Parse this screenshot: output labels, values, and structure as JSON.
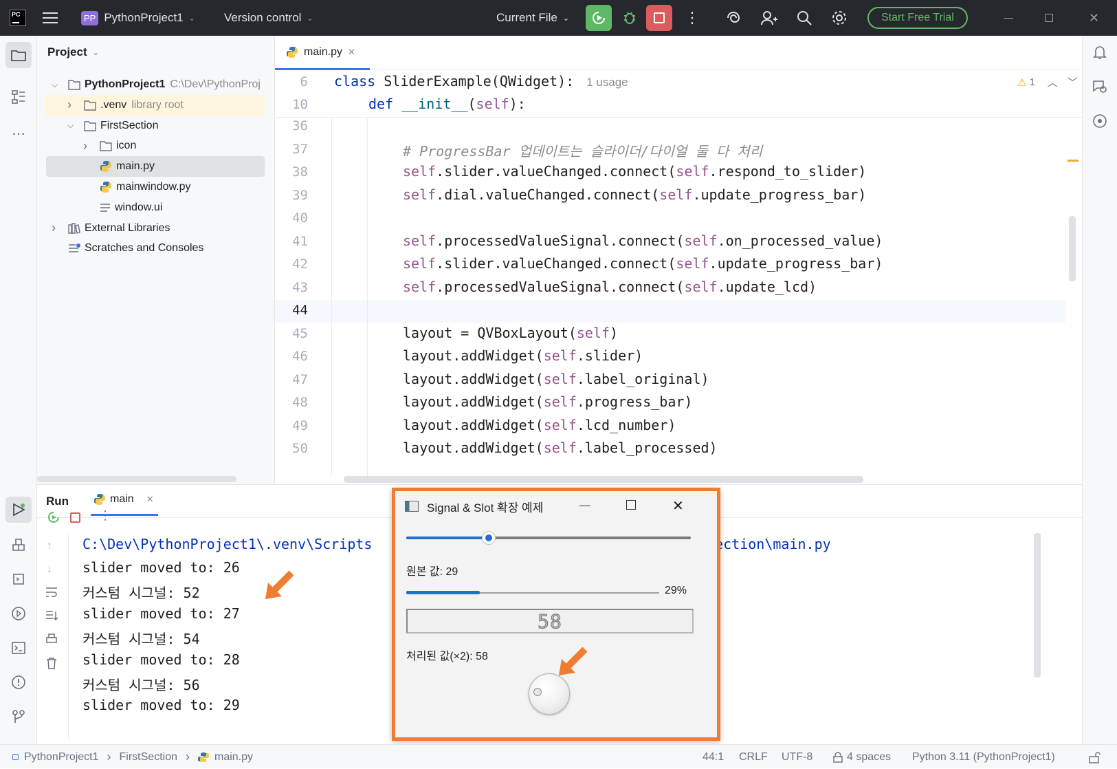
{
  "titlebar": {
    "app_logo": "PC",
    "project_badge": "PP",
    "project_name": "PythonProject1",
    "vcs": "Version control",
    "run_config": "Current File",
    "trial_button": "Start Free Trial",
    "icons": [
      "hamburger-menu-icon",
      "rerun-icon",
      "debug-icon",
      "stop-icon",
      "more-icon",
      "ai-assistant-icon",
      "add-user-icon",
      "search-icon",
      "settings-icon",
      "minimize-icon",
      "maximize-icon",
      "close-icon"
    ]
  },
  "project_panel": {
    "title": "Project",
    "tree": [
      {
        "label": "PythonProject1",
        "extra": "C:\\Dev\\PythonProj",
        "depth": 0,
        "kind": "folder",
        "arrow": "open"
      },
      {
        "label": ".venv",
        "extra": "library root",
        "depth": 1,
        "kind": "folder",
        "arrow": "closed"
      },
      {
        "label": "FirstSection",
        "extra": "",
        "depth": 1,
        "kind": "folder",
        "arrow": "open"
      },
      {
        "label": "icon",
        "extra": "",
        "depth": 2,
        "kind": "folder",
        "arrow": "closed"
      },
      {
        "label": "main.py",
        "extra": "",
        "depth": 2,
        "kind": "python",
        "arrow": "none"
      },
      {
        "label": "mainwindow.py",
        "extra": "",
        "depth": 2,
        "kind": "python",
        "arrow": "none"
      },
      {
        "label": "window.ui",
        "extra": "",
        "depth": 2,
        "kind": "ui",
        "arrow": "none"
      },
      {
        "label": "External Libraries",
        "extra": "",
        "depth": 0,
        "kind": "library",
        "arrow": "closed"
      },
      {
        "label": "Scratches and Consoles",
        "extra": "",
        "depth": 0,
        "kind": "scratch",
        "arrow": "none"
      }
    ]
  },
  "editor": {
    "tab": "main.py",
    "sticky": [
      {
        "num": "6",
        "tokens": [
          [
            "kw",
            "class "
          ],
          [
            "",
            "SliderExample(QWidget):"
          ]
        ],
        "hint": "1 usage",
        "indent": 0
      },
      {
        "num": "10",
        "tokens": [
          [
            "kw",
            "def "
          ],
          [
            "fn",
            "__init__"
          ],
          [
            "",
            "("
          ],
          [
            "sf",
            "self"
          ],
          [
            "",
            "):"
          ]
        ],
        "hint": "",
        "indent": 1
      }
    ],
    "warnings": "1",
    "lines": [
      {
        "num": "36",
        "tokens": []
      },
      {
        "num": "37",
        "tokens": [
          [
            "cm",
            "# ProgressBar 업데이트는 슬라이더/다이얼 둘 다 처리"
          ]
        ]
      },
      {
        "num": "38",
        "tokens": [
          [
            "sf",
            "self"
          ],
          [
            "",
            ".slider.valueChanged.connect("
          ],
          [
            "sf",
            "self"
          ],
          [
            "",
            ".respond_to_slider)"
          ]
        ]
      },
      {
        "num": "39",
        "tokens": [
          [
            "sf",
            "self"
          ],
          [
            "",
            ".dial.valueChanged.connect("
          ],
          [
            "sf",
            "self"
          ],
          [
            "",
            ".update_progress_bar)"
          ]
        ]
      },
      {
        "num": "40",
        "tokens": []
      },
      {
        "num": "41",
        "tokens": [
          [
            "sf",
            "self"
          ],
          [
            "",
            ".processedValueSignal.connect("
          ],
          [
            "sf",
            "self"
          ],
          [
            "",
            ".on_processed_value)"
          ]
        ]
      },
      {
        "num": "42",
        "tokens": [
          [
            "sf",
            "self"
          ],
          [
            "",
            ".slider.valueChanged.connect("
          ],
          [
            "sf",
            "self"
          ],
          [
            "",
            ".update_progress_bar)"
          ]
        ]
      },
      {
        "num": "43",
        "tokens": [
          [
            "sf",
            "self"
          ],
          [
            "",
            ".processedValueSignal.connect("
          ],
          [
            "sf",
            "self"
          ],
          [
            "",
            ".update_lcd)"
          ]
        ]
      },
      {
        "num": "44",
        "tokens": []
      },
      {
        "num": "45",
        "tokens": [
          [
            "",
            "layout = QVBoxLayout("
          ],
          [
            "sf",
            "self"
          ],
          [
            "",
            ")"
          ]
        ]
      },
      {
        "num": "46",
        "tokens": [
          [
            "",
            "layout.addWidget("
          ],
          [
            "sf",
            "self"
          ],
          [
            "",
            ".slider)"
          ]
        ]
      },
      {
        "num": "47",
        "tokens": [
          [
            "",
            "layout.addWidget("
          ],
          [
            "sf",
            "self"
          ],
          [
            "",
            ".label_original)"
          ]
        ]
      },
      {
        "num": "48",
        "tokens": [
          [
            "",
            "layout.addWidget("
          ],
          [
            "sf",
            "self"
          ],
          [
            "",
            ".progress_bar)"
          ]
        ]
      },
      {
        "num": "49",
        "tokens": [
          [
            "",
            "layout.addWidget("
          ],
          [
            "sf",
            "self"
          ],
          [
            "",
            ".lcd_number)"
          ]
        ]
      },
      {
        "num": "50",
        "tokens": [
          [
            "",
            "layout.addWidget("
          ],
          [
            "sf",
            "self"
          ],
          [
            "",
            ".label_processed)"
          ]
        ]
      }
    ]
  },
  "run_panel": {
    "title": "Run",
    "tab": "main",
    "command_left": "C:\\Dev\\PythonProject1\\.venv\\Scripts",
    "command_right": "tSection\\main.py",
    "output": [
      "slider moved to: 26",
      "커스텀 시그널: 52",
      "slider moved to: 27",
      "커스텀 시그널: 54",
      "slider moved to: 28",
      "커스텀 시그널: 56",
      "slider moved to: 29"
    ]
  },
  "popup": {
    "title": "Signal & Slot 확장 예제",
    "slider_value": 29,
    "slider_max": 100,
    "original_label": "원본 값: 29",
    "progress_value": 29,
    "progress_text": "29%",
    "lcd_value": "58",
    "processed_label": "처리된 값(×2): 58"
  },
  "statusbar": {
    "crumbs": [
      "PythonProject1",
      "FirstSection",
      "main.py"
    ],
    "position": "44:1",
    "line_sep": "CRLF",
    "encoding": "UTF-8",
    "indent": "4 spaces",
    "interpreter": "Python 3.11 (PythonProject1)"
  },
  "colors": {
    "accent": "#ed7d31",
    "run_green": "#5fb865",
    "stop_red": "#db5c5c",
    "trial_green": "#5fb865"
  }
}
